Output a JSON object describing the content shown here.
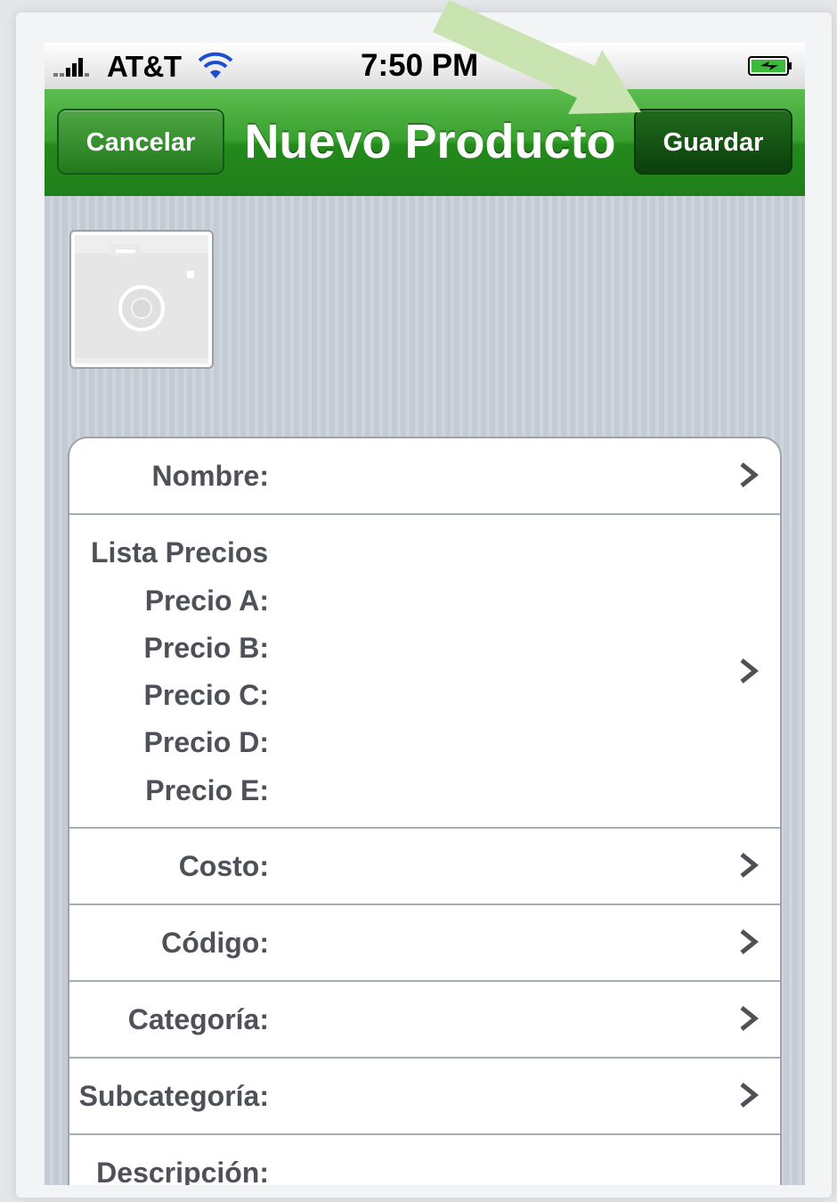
{
  "status_bar": {
    "carrier": "AT&T",
    "time": "7:50 PM",
    "signal_icon": "signal-bars-icon",
    "wifi_icon": "wifi-icon",
    "battery_icon": "battery-charging-icon"
  },
  "nav_bar": {
    "cancel_label": "Cancelar",
    "title": "Nuevo Producto",
    "save_label": "Guardar",
    "color": "#2e9526"
  },
  "photo": {
    "icon": "camera-placeholder-icon"
  },
  "form": {
    "nombre_label": "Nombre:",
    "lista_precios": {
      "title": "Lista Precios",
      "precios": [
        "Precio A:",
        "Precio B:",
        "Precio C:",
        "Precio D:",
        "Precio E:"
      ]
    },
    "costo_label": "Costo:",
    "codigo_label": "Código:",
    "categoria_label": "Categoría:",
    "subcategoria_label": "Subcategoría:",
    "descripcion_label": "Descripción:"
  },
  "annotation": {
    "arrow_color": "#c9e4b0"
  }
}
